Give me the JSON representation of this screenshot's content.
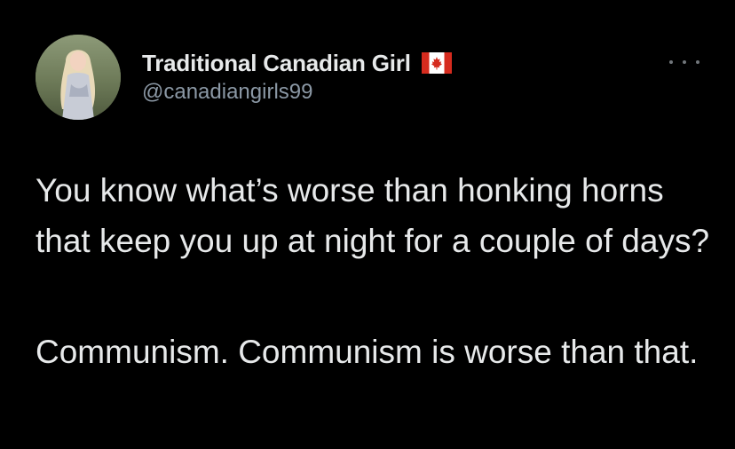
{
  "tweet": {
    "author": {
      "display_name": "Traditional Canadian Girl",
      "handle": "@canadiangirls99",
      "avatar_icon": "profile-photo",
      "flag_icon": "canada-flag-icon"
    },
    "menu_icon": "more-options-icon",
    "paragraphs": [
      "You know what’s worse than honking horns that keep you up at night for a couple of days?",
      "Communism. Communism is worse than that."
    ],
    "colors": {
      "background": "#000000",
      "text": "#e7e9ea",
      "secondary": "#8b98a5",
      "flag_red": "#d52b1e"
    }
  }
}
